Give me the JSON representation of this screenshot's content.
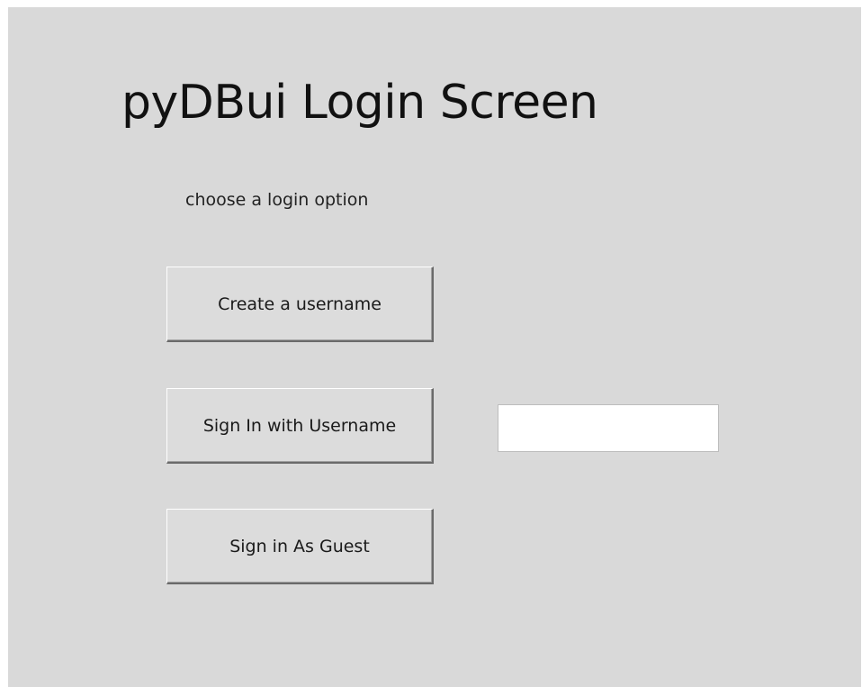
{
  "window": {
    "title": "pyDBui Login Screen",
    "subtitle": "choose a login option"
  },
  "buttons": {
    "create_username": "Create a username",
    "sign_in_username": "Sign In with Username",
    "sign_in_guest": "Sign in As Guest"
  },
  "username_field": {
    "value": "",
    "placeholder": ""
  },
  "colors": {
    "background": "#d9d9d9",
    "button_face": "#dcdcdc",
    "input_background": "#ffffff"
  }
}
